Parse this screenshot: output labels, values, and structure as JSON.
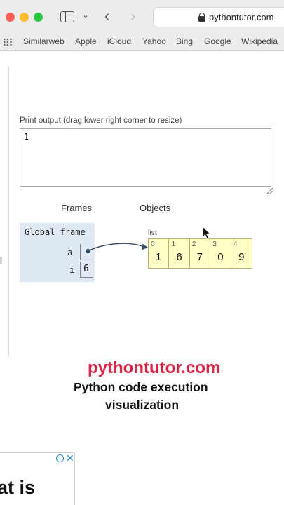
{
  "browser": {
    "url": "pythontutor.com",
    "bookmarks": [
      "Similarweb",
      "Apple",
      "iCloud",
      "Yahoo",
      "Bing",
      "Google",
      "Wikipedia"
    ]
  },
  "print_output": {
    "label": "Print output (drag lower right corner to resize)",
    "text": "1"
  },
  "headers": {
    "frames": "Frames",
    "objects": "Objects"
  },
  "global_frame": {
    "title": "Global frame",
    "vars": [
      {
        "name": "a",
        "value": ""
      },
      {
        "name": "i",
        "value": "6"
      }
    ]
  },
  "list_object": {
    "label": "list",
    "indices": [
      "0",
      "1",
      "2",
      "3",
      "4"
    ],
    "values": [
      "1",
      "6",
      "7",
      "0",
      "9"
    ]
  },
  "overlay": {
    "brand": "pythontutor.com",
    "line1": "Python code execution",
    "line2": "visualization"
  },
  "ad": {
    "info": "i",
    "close": "✕",
    "text": "at is"
  },
  "colors": {
    "brand_red": "#dc2445",
    "frame_bg": "#dfe9f3",
    "list_bg": "#ffffc6",
    "arrow": "#3a4e66"
  }
}
